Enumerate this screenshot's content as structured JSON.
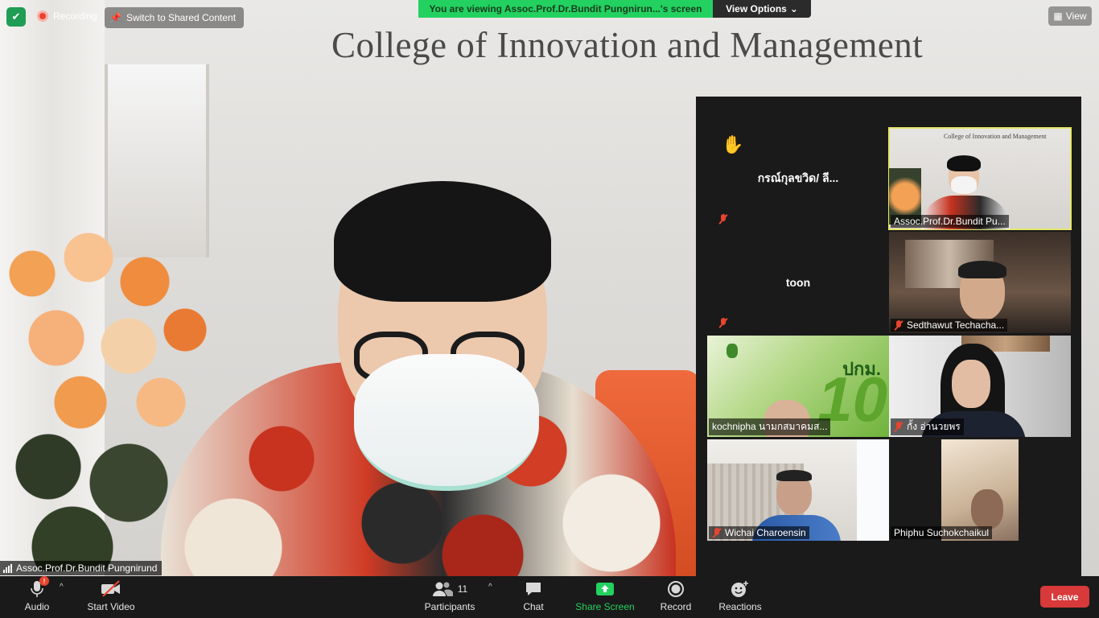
{
  "top_bar": {
    "recording_label": "Recording",
    "switch_label": "Switch to Shared Content",
    "viewing_banner": "You are viewing Assoc.Prof.Dr.Bundit Pungnirun...'s screen",
    "view_options_label": "View Options",
    "view_label": "View"
  },
  "main_video": {
    "wall_title": "College of Innovation and Management",
    "speaker_name": "Assoc.Prof.Dr.Bundit Pungnirund"
  },
  "gallery": {
    "tiles": [
      {
        "name": "กรณ์กุลขวิด/ ลี...",
        "label": "",
        "video": false,
        "muted": true,
        "hand_raised": true
      },
      {
        "name": "",
        "label": "Assoc.Prof.Dr.Bundit Pu...",
        "video": true,
        "muted": false,
        "active": true,
        "mini_title": "College of Innovation and Management"
      },
      {
        "name": "toon",
        "label": "",
        "video": false,
        "muted": true
      },
      {
        "name": "",
        "label": "Sedthawut Techacha...",
        "video": true,
        "muted": true
      },
      {
        "name": "",
        "label": "kochnipha นามกสมาคมส...",
        "video": true,
        "muted": false,
        "overlay_text": "ปกม.",
        "overlay_number": "10"
      },
      {
        "name": "",
        "label": "กั้ง อ่านวยพร",
        "video": true,
        "muted": true
      },
      {
        "name": "",
        "label": "Wichai Charoensin",
        "video": true,
        "muted": true
      },
      {
        "name": "",
        "label": "Phiphu Suchokchaikul",
        "video": true,
        "muted": false
      }
    ]
  },
  "toolbar": {
    "audio_label": "Audio",
    "start_video_label": "Start Video",
    "participants_label": "Participants",
    "participants_count": "11",
    "chat_label": "Chat",
    "share_screen_label": "Share Screen",
    "record_label": "Record",
    "reactions_label": "Reactions",
    "leave_label": "Leave",
    "audio_alert": "!"
  },
  "colors": {
    "banner_green": "#23d160",
    "share_green": "#23d160",
    "leave_red": "#d8393a",
    "active_speaker_outline": "#e6e66a",
    "muted_red": "#e8442f"
  }
}
